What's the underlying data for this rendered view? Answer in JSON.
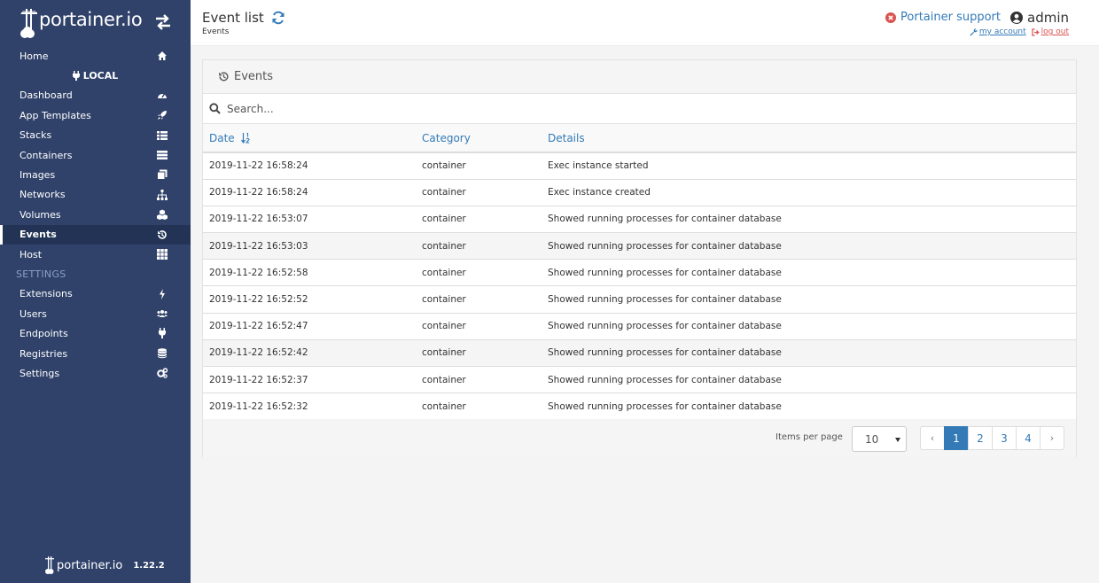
{
  "sidebar": {
    "brand_text": "portainer.io",
    "nav": [
      {
        "label": "Home",
        "icon": "home-icon"
      },
      {
        "label": "Dashboard",
        "icon": "dashboard-icon"
      },
      {
        "label": "App Templates",
        "icon": "rocket-icon"
      },
      {
        "label": "Stacks",
        "icon": "list-icon"
      },
      {
        "label": "Containers",
        "icon": "server-icon"
      },
      {
        "label": "Images",
        "icon": "clone-icon"
      },
      {
        "label": "Networks",
        "icon": "sitemap-icon"
      },
      {
        "label": "Volumes",
        "icon": "cubes-icon"
      },
      {
        "label": "Events",
        "icon": "history-icon"
      },
      {
        "label": "Host",
        "icon": "th-icon"
      },
      {
        "label": "Extensions",
        "icon": "bolt-icon"
      },
      {
        "label": "Users",
        "icon": "users-icon"
      },
      {
        "label": "Endpoints",
        "icon": "plug-icon"
      },
      {
        "label": "Registries",
        "icon": "database-icon"
      },
      {
        "label": "Settings",
        "icon": "cogs-icon"
      }
    ],
    "endpoint_label": "LOCAL",
    "settings_section": "SETTINGS",
    "active_item": "Events",
    "footer_text": "portainer.io",
    "version": "1.22.2"
  },
  "header": {
    "title": "Event list",
    "breadcrumb": "Events",
    "support": "Portainer support",
    "user": "admin",
    "my_account": "my account",
    "log_out": "log out"
  },
  "panel": {
    "heading": "Events",
    "search_placeholder": "Search...",
    "columns": {
      "date": "Date",
      "category": "Category",
      "details": "Details"
    },
    "rows": [
      {
        "date": "2019-11-22 16:58:24",
        "category": "container",
        "details": "Exec instance started"
      },
      {
        "date": "2019-11-22 16:58:24",
        "category": "container",
        "details": "Exec instance created"
      },
      {
        "date": "2019-11-22 16:53:07",
        "category": "container",
        "details": "Showed running processes for container database"
      },
      {
        "date": "2019-11-22 16:53:03",
        "category": "container",
        "details": "Showed running processes for container database"
      },
      {
        "date": "2019-11-22 16:52:58",
        "category": "container",
        "details": "Showed running processes for container database"
      },
      {
        "date": "2019-11-22 16:52:52",
        "category": "container",
        "details": "Showed running processes for container database"
      },
      {
        "date": "2019-11-22 16:52:47",
        "category": "container",
        "details": "Showed running processes for container database"
      },
      {
        "date": "2019-11-22 16:52:42",
        "category": "container",
        "details": "Showed running processes for container database"
      },
      {
        "date": "2019-11-22 16:52:37",
        "category": "container",
        "details": "Showed running processes for container database"
      },
      {
        "date": "2019-11-22 16:52:32",
        "category": "container",
        "details": "Showed running processes for container database"
      }
    ],
    "items_per_page_label": "Items per page",
    "items_per_page": "10",
    "pages": [
      "1",
      "2",
      "3",
      "4"
    ],
    "prev": "‹",
    "next": "›",
    "active_page": "1"
  },
  "colors": {
    "sidebar_bg": "#30426a",
    "accent": "#337ab7",
    "danger": "#d9534f"
  }
}
